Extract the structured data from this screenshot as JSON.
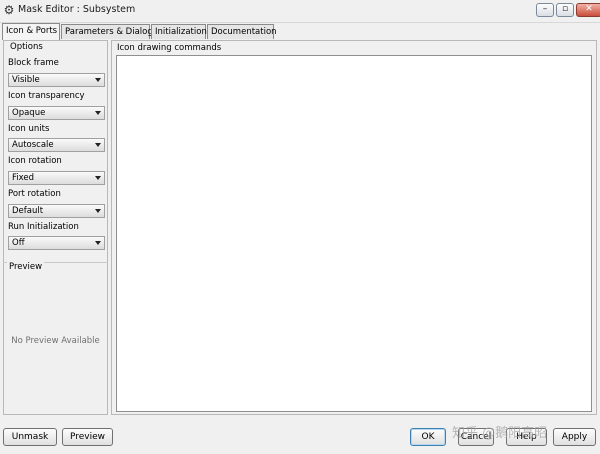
{
  "window": {
    "title": "Mask Editor : Subsystem",
    "controls": [
      "minimize-icon",
      "maximize-icon",
      "close-icon"
    ]
  },
  "tabs": [
    {
      "label": "Icon & Ports",
      "active": true
    },
    {
      "label": "Parameters & Dialog",
      "active": false
    },
    {
      "label": "Initialization",
      "active": false
    },
    {
      "label": "Documentation",
      "active": false
    }
  ],
  "options": {
    "legend": "Options",
    "fields": [
      {
        "label": "Block frame",
        "value": "Visible"
      },
      {
        "label": "Icon transparency",
        "value": "Opaque"
      },
      {
        "label": "Icon units",
        "value": "Autoscale"
      },
      {
        "label": "Icon rotation",
        "value": "Fixed"
      },
      {
        "label": "Port rotation",
        "value": "Default"
      },
      {
        "label": "Run Initialization",
        "value": "Off"
      }
    ]
  },
  "preview": {
    "legend": "Preview",
    "empty_text": "No Preview Available"
  },
  "drawing_commands": {
    "label": "Icon drawing commands",
    "value": ""
  },
  "buttons": {
    "unmask": "Unmask",
    "preview": "Preview",
    "ok": "OK",
    "cancel": "Cancel",
    "help": "Help",
    "apply": "Apply"
  },
  "watermark": "知乎 @鹅阳高昭"
}
